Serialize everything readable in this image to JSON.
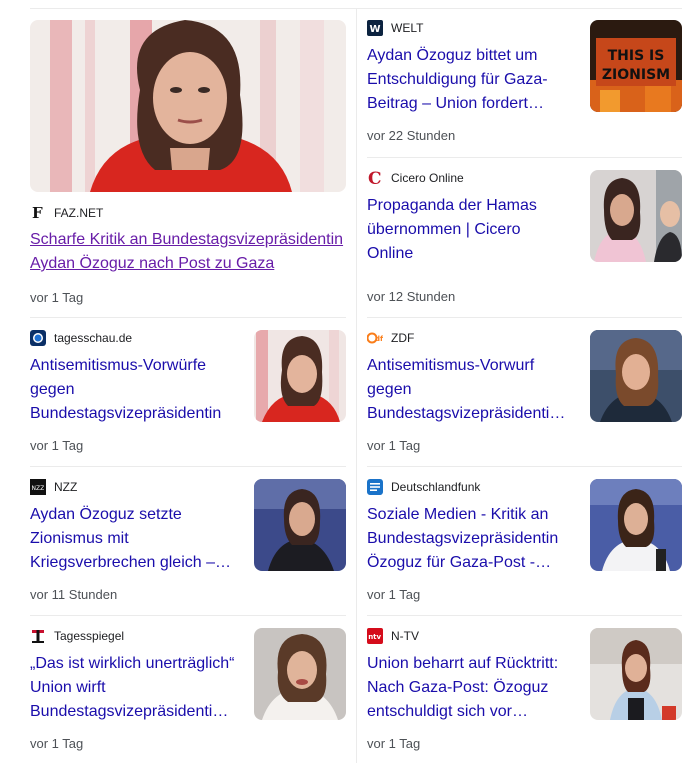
{
  "featured": {
    "source": "FAZ.NET",
    "title": "Scharfe Kritik an Bundestagsvizepräsidentin Aydan Özoguz nach Post zu Gaza",
    "time": "vor 1 Tag",
    "icon": "faz-logo-icon"
  },
  "left": [
    {
      "source": "tagesschau.de",
      "title": "Antisemitismus-Vorwürfe gegen Bundestagsvizepräsidentin",
      "time": "vor 1 Tag",
      "icon": "tagesschau-logo-icon"
    },
    {
      "source": "NZZ",
      "title": "Aydan Özoguz setzte Zionismus mit Kriegsverbrechen gleich –…",
      "time": "vor 11 Stunden",
      "icon": "nzz-logo-icon"
    },
    {
      "source": "Tagesspiegel",
      "title": "„Das ist wirklich unerträglich“ Union wirft Bundestagsvizepräsidenti…",
      "time": "vor 1 Tag",
      "icon": "tagesspiegel-logo-icon"
    }
  ],
  "right": [
    {
      "source": "WELT",
      "title": "Aydan Özoguz bittet um Entschuldigung für Gaza-Beitrag – Union fordert…",
      "time": "vor 22 Stunden",
      "icon": "welt-logo-icon",
      "thumb_text": [
        "THIS IS",
        "ZIONISM"
      ]
    },
    {
      "source": "Cicero Online",
      "title": "Propaganda der Hamas übernommen | Cicero Online",
      "time": "vor 12 Stunden",
      "icon": "cicero-logo-icon"
    },
    {
      "source": "ZDF",
      "title": "Antisemitismus-Vorwurf gegen Bundestagsvizepräsidenti…",
      "time": "vor 1 Tag",
      "icon": "zdf-logo-icon"
    },
    {
      "source": "Deutschlandfunk",
      "title": "Soziale Medien - Kritik an Bundestagsvizepräsidentin Özoguz für Gaza-Post -…",
      "time": "vor 1 Tag",
      "icon": "deutschlandfunk-logo-icon"
    },
    {
      "source": "N-TV",
      "title": "Union beharrt auf Rücktritt: Nach Gaza-Post: Özoguz entschuldigt sich vor…",
      "time": "vor 1 Tag",
      "icon": "ntv-logo-icon"
    }
  ],
  "colors": {
    "link": "#1a0dab",
    "visited": "#681da8",
    "meta": "#4d5156",
    "divider": "#ebebeb"
  }
}
